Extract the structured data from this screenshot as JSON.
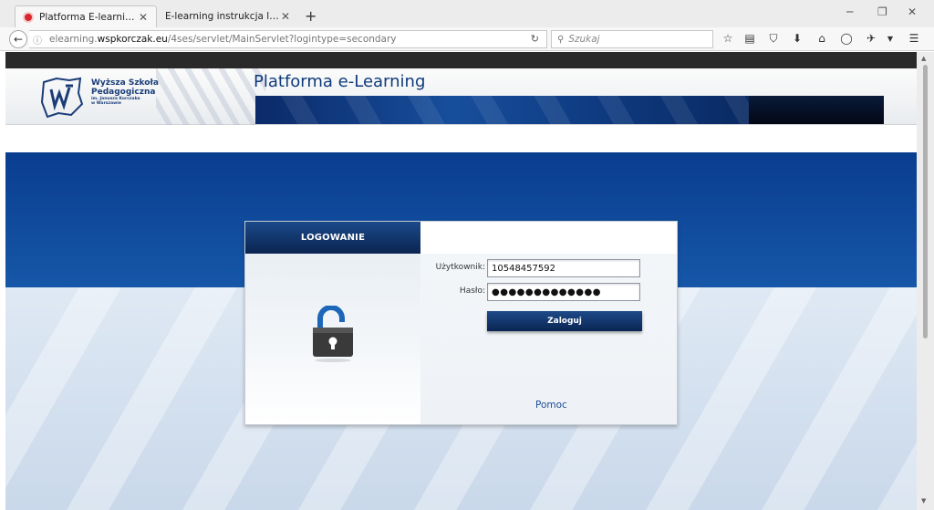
{
  "browser": {
    "tabs": [
      {
        "title": "Platforma E-learningowa ...",
        "active": true
      },
      {
        "title": "E-learning instrukcja logowania",
        "active": false
      }
    ],
    "url_prefix": "elearning.",
    "url_domain": "wspkorczak.eu",
    "url_path": "/4ses/servlet/MainServlet?logintype=secondary",
    "search_placeholder": "Szukaj"
  },
  "header": {
    "logo_line1": "Wyższa Szkoła",
    "logo_line2": "Pedagogiczna",
    "logo_line3": "im. Janusza Korczaka",
    "logo_line4": "w Warszawie",
    "site_title": "Platforma e-Learning"
  },
  "login": {
    "heading": "LOGOWANIE",
    "user_label": "Użytkownik:",
    "user_value": "10548457592",
    "password_label": "Hasło:",
    "password_value": "●●●●●●●●●●●●●",
    "submit_label": "Zaloguj",
    "help_link": "Pomoc"
  },
  "colors": {
    "brand_blue": "#0f3a7a",
    "hero_blue": "#0a3d8f",
    "button_dark": "#0a2552"
  }
}
